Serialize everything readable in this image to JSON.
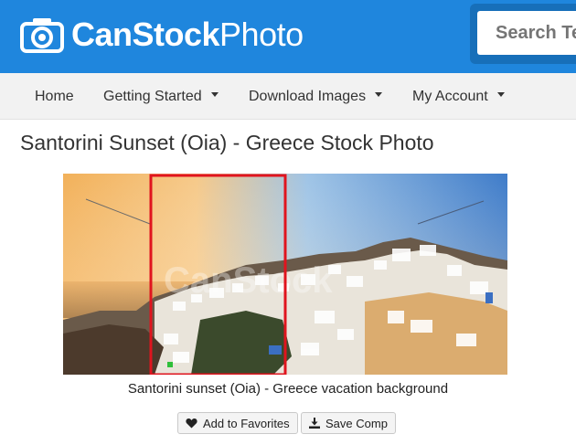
{
  "header": {
    "brand_bold": "CanStock",
    "brand_light": "Photo",
    "logo_icon": "camera-icon",
    "search_placeholder": "Search Te"
  },
  "nav": {
    "items": [
      {
        "label": "Home",
        "has_caret": false
      },
      {
        "label": "Getting Started",
        "has_caret": true
      },
      {
        "label": "Download Images",
        "has_caret": true
      },
      {
        "label": "My Account",
        "has_caret": true
      }
    ]
  },
  "page": {
    "title": "Santorini Sunset (Oia) - Greece Stock Photo"
  },
  "photo": {
    "caption": "Santorini sunset (Oia) - Greece vacation background",
    "watermark": "CanStock",
    "selection_color": "#e0141e"
  },
  "actions": {
    "favorites_label": "Add to Favorites",
    "favorites_icon": "heart-icon",
    "comp_label": "Save Comp",
    "comp_icon": "download-icon"
  },
  "colors": {
    "header_bg": "#1f86dd",
    "nav_bg": "#f2f2f2"
  }
}
